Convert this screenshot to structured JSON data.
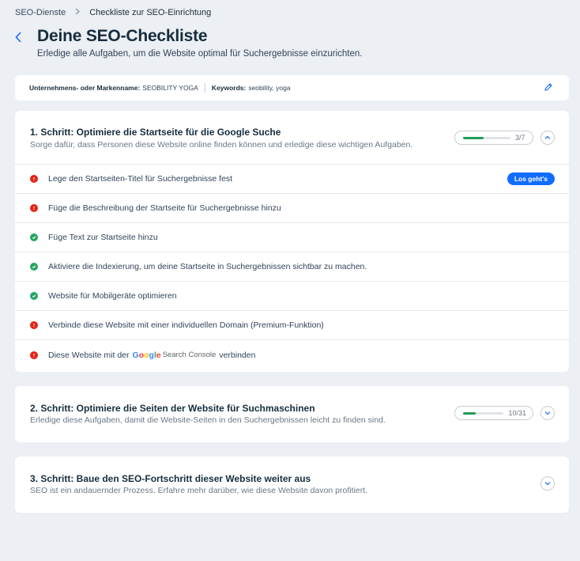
{
  "breadcrumb": {
    "parent": "SEO-Dienste",
    "current": "Checkliste zur SEO-Einrichtung"
  },
  "header": {
    "title": "Deine SEO-Checkliste",
    "subtitle": "Erledige alle Aufgaben, um die Website optimal für Suchergebnisse einzurichten."
  },
  "info": {
    "business_label": "Unternehmens- oder Markenname:",
    "business_value": "SEOBILITY YOGA",
    "keywords_label": "Keywords:",
    "keywords_value": "seobility, yoga"
  },
  "steps": [
    {
      "title": "1. Schritt: Optimiere die Startseite für die Google Suche",
      "description": "Sorge dafür, dass Personen diese Website online finden können und erledige diese wichtigen Aufgaben.",
      "progress": 0.43,
      "count": "3/7",
      "expanded": true,
      "tasks": [
        {
          "label": "Lege den Startseiten-Titel für Suchergebnisse fest",
          "status": "error",
          "action": "Los geht's"
        },
        {
          "label": "Füge die Beschreibung der Startseite für Suchergebnisse hinzu",
          "status": "error"
        },
        {
          "label": "Füge Text zur Startseite hinzu",
          "status": "done"
        },
        {
          "label": "Aktiviere die Indexierung, um deine Startseite in Suchergebnissen sichtbar zu machen.",
          "status": "done"
        },
        {
          "label": "Website für Mobilgeräte optimieren",
          "status": "done"
        },
        {
          "label": "Verbinde diese Website mit einer individuellen Domain (Premium-Funktion)",
          "status": "error"
        },
        {
          "label_before": "Diese Website mit der",
          "logo_brand": "Google",
          "logo_product": "Search Console",
          "label_after": "verbinden",
          "status": "error"
        }
      ]
    },
    {
      "title": "2. Schritt: Optimiere die Seiten der Website für Suchmaschinen",
      "description": "Erledige diese Aufgaben, damit die Website-Seiten in den Suchergebnissen leicht zu finden sind.",
      "progress": 0.32,
      "count": "10/31",
      "expanded": false
    },
    {
      "title": "3. Schritt: Baue den SEO-Fortschritt dieser Website weiter aus",
      "description": "SEO ist ein andauernder Prozess. Erfahre mehr darüber, wie diese Website davon profitiert.",
      "expanded": false
    }
  ],
  "colors": {
    "accent": "#116dff",
    "error": "#e62214",
    "success": "#25a55f",
    "progress": "#1f9d55"
  }
}
